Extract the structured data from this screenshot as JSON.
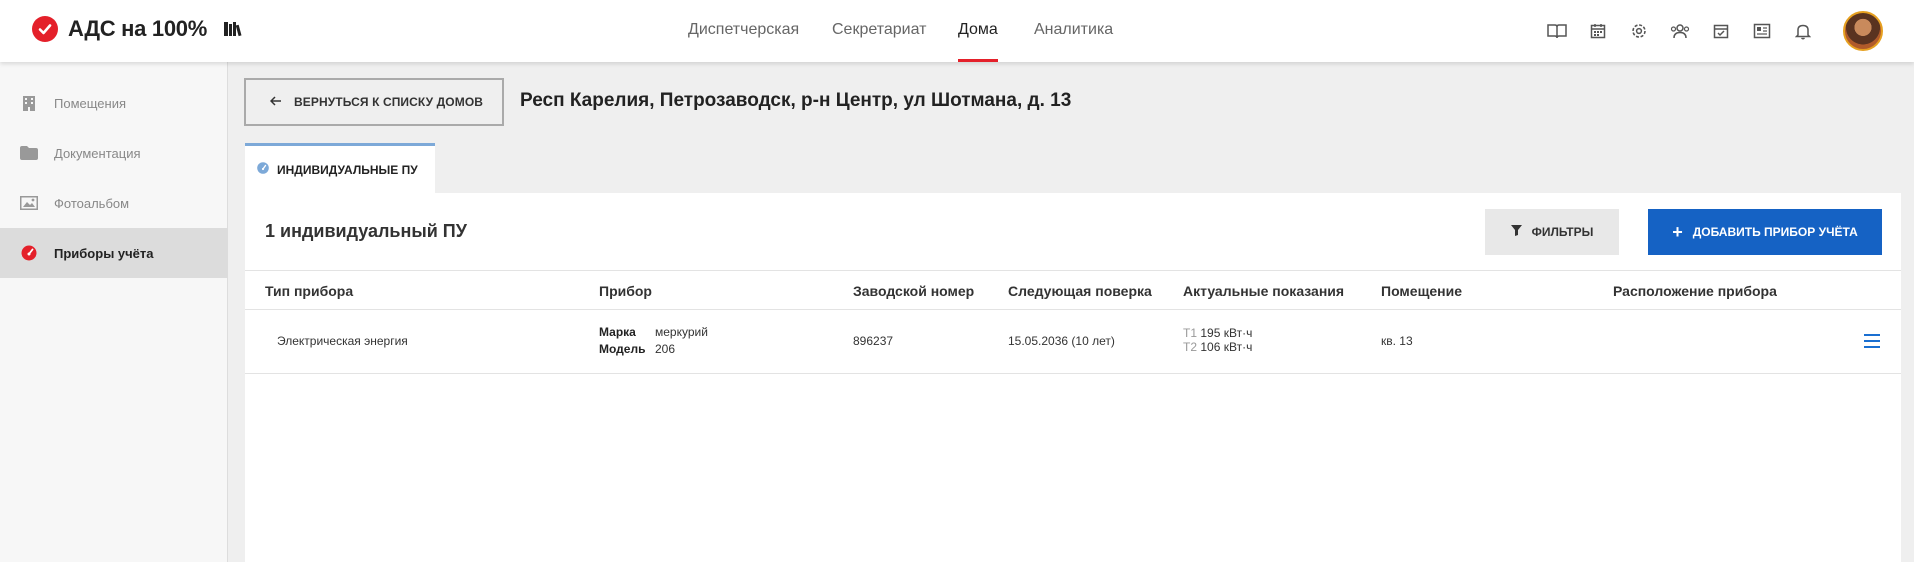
{
  "brand": {
    "name": "АДС на 100%",
    "accent": "#e4202a"
  },
  "nav": {
    "items": [
      {
        "label": "Диспетчерская",
        "active": false
      },
      {
        "label": "Секретариат",
        "active": false
      },
      {
        "label": "Дома",
        "active": true
      },
      {
        "label": "Аналитика",
        "active": false
      }
    ]
  },
  "top_icons": [
    "book-icon",
    "calendar-icon",
    "gear-icon",
    "users-icon",
    "calendar-check-icon",
    "news-icon",
    "bell-icon"
  ],
  "sidebar": {
    "items": [
      {
        "label": "Помещения",
        "icon": "building-icon",
        "active": false
      },
      {
        "label": "Документация",
        "icon": "folder-icon",
        "active": false
      },
      {
        "label": "Фотоальбом",
        "icon": "photo-album-icon",
        "active": false
      },
      {
        "label": "Приборы учёта",
        "icon": "meter-gauge-icon",
        "active": true
      }
    ]
  },
  "back_button": {
    "label": "ВЕРНУТЬСЯ К СПИСКУ ДОМОВ"
  },
  "address": "Респ Карелия, Петрозаводск, р-н Центр, ул Шотмана, д. 13",
  "tabs": [
    {
      "label": "ИНДИВИДУАЛЬНЫЕ ПУ",
      "active": true
    }
  ],
  "panel": {
    "count_title": "1 индивидуальный ПУ",
    "filter_label": "ФИЛЬТРЫ",
    "add_label": "ДОБАВИТЬ ПРИБОР УЧЁТА",
    "add_color": "#1562c4"
  },
  "table": {
    "columns": [
      "Тип прибора",
      "Прибор",
      "Заводской номер",
      "Следующая поверка",
      "Актуальные показания",
      "Помещение",
      "Расположение прибора"
    ],
    "rows": [
      {
        "type": "Электрическая энергия",
        "brand_key": "Марка",
        "brand_value": "меркурий",
        "model_key": "Модель",
        "model_value": "206",
        "serial": "896237",
        "next_check": "15.05.2036 (10 лет)",
        "readings": [
          {
            "tariff": "T1",
            "value": "195 кВт·ч"
          },
          {
            "tariff": "T2",
            "value": "106 кВт·ч"
          }
        ],
        "room": "кв. 13",
        "location": ""
      }
    ]
  }
}
